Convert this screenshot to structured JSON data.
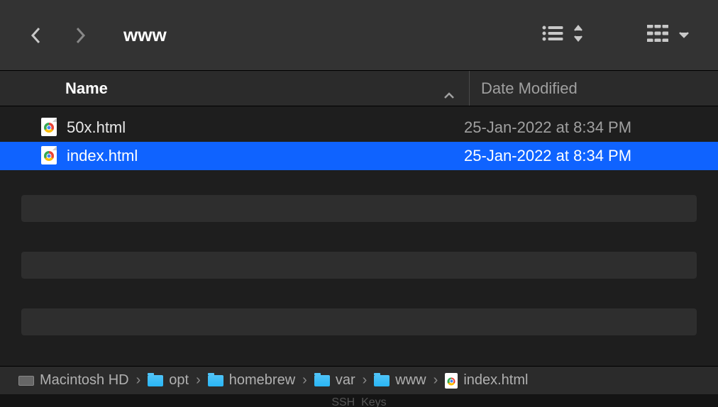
{
  "toolbar": {
    "title": "www"
  },
  "columns": {
    "name": "Name",
    "date": "Date Modified"
  },
  "files": [
    {
      "name": "50x.html",
      "date": "25-Jan-2022 at 8:34 PM",
      "selected": false
    },
    {
      "name": "index.html",
      "date": "25-Jan-2022 at 8:34 PM",
      "selected": true
    }
  ],
  "path": [
    {
      "label": "Macintosh HD",
      "type": "drive"
    },
    {
      "label": "opt",
      "type": "folder"
    },
    {
      "label": "homebrew",
      "type": "folder"
    },
    {
      "label": "var",
      "type": "folder"
    },
    {
      "label": "www",
      "type": "folder"
    },
    {
      "label": "index.html",
      "type": "html"
    }
  ],
  "background_hint": "SSH_Keys"
}
